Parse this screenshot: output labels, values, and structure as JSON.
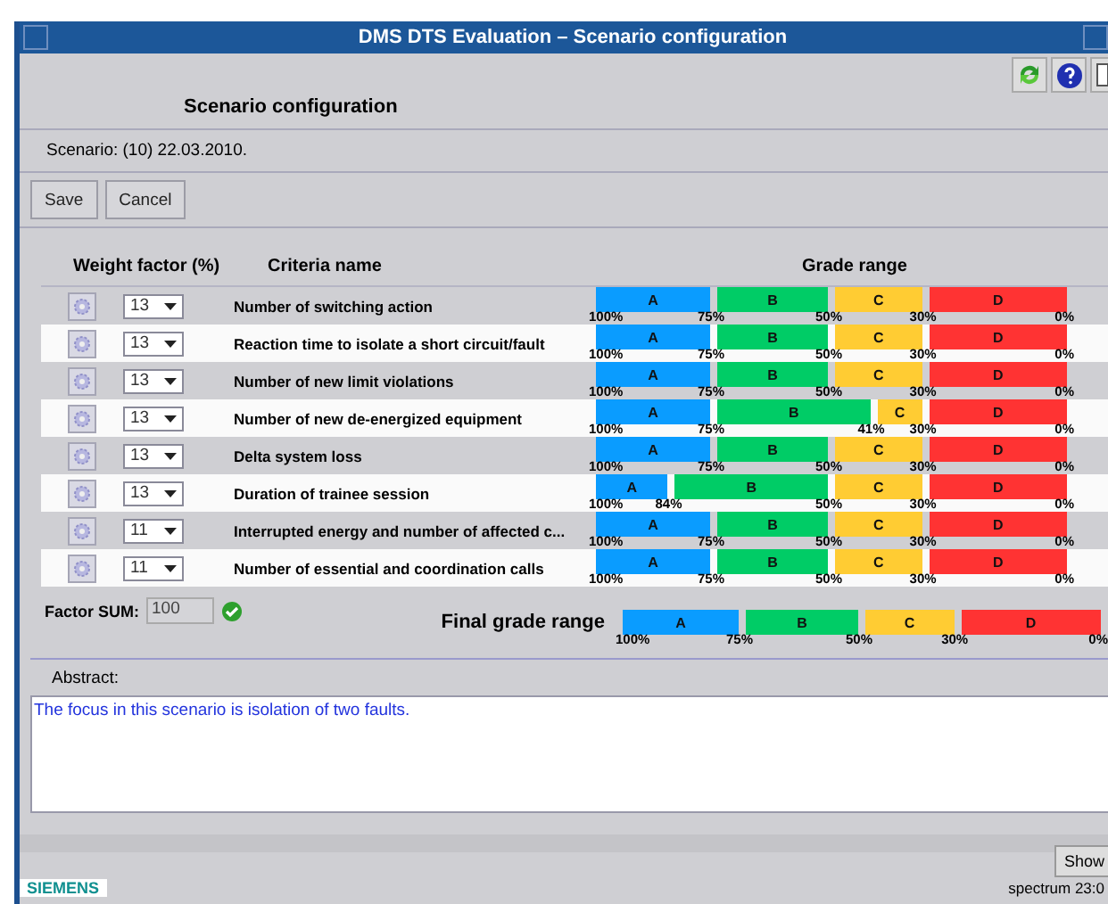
{
  "window": {
    "title": "DMS DTS Evaluation – Scenario configuration"
  },
  "heading": "Scenario configuration",
  "scenario": "Scenario: (10) 22.03.2010.",
  "buttons": [
    "Save",
    "Cancel"
  ],
  "columns": [
    "Weight factor (%)",
    "Criteria name",
    "Grade range"
  ],
  "criteria": [
    {
      "weight": "13",
      "name": "Number of switching action",
      "grades": [
        {
          "label": "A",
          "color": "#0a9cff"
        },
        {
          "label": "B",
          "color": "#00cc66"
        },
        {
          "label": "C",
          "color": "#ffcc33"
        },
        {
          "label": "D",
          "color": "#ff3333"
        }
      ],
      "ticks": [
        "100%",
        "75%",
        "50%",
        "30%",
        "0%"
      ]
    },
    {
      "weight": "13",
      "name": "Reaction time to isolate a short circuit/fault",
      "grades": [
        {
          "label": "A",
          "color": "#0a9cff"
        },
        {
          "label": "B",
          "color": "#00cc66"
        },
        {
          "label": "C",
          "color": "#ffcc33"
        },
        {
          "label": "D",
          "color": "#ff3333"
        }
      ],
      "ticks": [
        "100%",
        "75%",
        "50%",
        "30%",
        "0%"
      ]
    },
    {
      "weight": "13",
      "name": "Number of new limit violations",
      "grades": [
        {
          "label": "A",
          "color": "#0a9cff"
        },
        {
          "label": "B",
          "color": "#00cc66"
        },
        {
          "label": "C",
          "color": "#ffcc33"
        },
        {
          "label": "D",
          "color": "#ff3333"
        }
      ],
      "ticks": [
        "100%",
        "75%",
        "50%",
        "30%",
        "0%"
      ]
    },
    {
      "weight": "13",
      "name": "Number of new de-energized equipment",
      "grades": [
        {
          "label": "A",
          "color": "#0a9cff"
        },
        {
          "label": "B",
          "color": "#00cc66"
        },
        {
          "label": "C",
          "color": "#ffcc33"
        },
        {
          "label": "D",
          "color": "#ff3333"
        }
      ],
      "ticks": [
        "100%",
        "75%",
        "41%",
        "30%",
        "0%"
      ]
    },
    {
      "weight": "13",
      "name": "Delta system loss",
      "grades": [
        {
          "label": "A",
          "color": "#0a9cff"
        },
        {
          "label": "B",
          "color": "#00cc66"
        },
        {
          "label": "C",
          "color": "#ffcc33"
        },
        {
          "label": "D",
          "color": "#ff3333"
        }
      ],
      "ticks": [
        "100%",
        "75%",
        "50%",
        "30%",
        "0%"
      ]
    },
    {
      "weight": "13",
      "name": "Duration of trainee session",
      "grades": [
        {
          "label": "A",
          "color": "#0a9cff"
        },
        {
          "label": "B",
          "color": "#00cc66"
        },
        {
          "label": "C",
          "color": "#ffcc33"
        },
        {
          "label": "D",
          "color": "#ff3333"
        }
      ],
      "ticks": [
        "100%",
        "84%",
        "50%",
        "30%",
        "0%"
      ]
    },
    {
      "weight": "11",
      "name": "Interrupted energy and number of affected c...",
      "grades": [
        {
          "label": "A",
          "color": "#0a9cff"
        },
        {
          "label": "B",
          "color": "#00cc66"
        },
        {
          "label": "C",
          "color": "#ffcc33"
        },
        {
          "label": "D",
          "color": "#ff3333"
        }
      ],
      "ticks": [
        "100%",
        "75%",
        "50%",
        "30%",
        "0%"
      ]
    },
    {
      "weight": "11",
      "name": "Number of essential and coordination calls",
      "grades": [
        {
          "label": "A",
          "color": "#0a9cff"
        },
        {
          "label": "B",
          "color": "#00cc66"
        },
        {
          "label": "C",
          "color": "#ffcc33"
        },
        {
          "label": "D",
          "color": "#ff3333"
        }
      ],
      "ticks": [
        "100%",
        "75%",
        "50%",
        "30%",
        "0%"
      ]
    }
  ],
  "factor_sum": {
    "label": "Factor SUM:",
    "value": "100",
    "valid": true
  },
  "final_grade": {
    "label": "Final grade range",
    "grades": [
      {
        "label": "A",
        "color": "#0a9cff"
      },
      {
        "label": "B",
        "color": "#00cc66"
      },
      {
        "label": "C",
        "color": "#ffcc33"
      },
      {
        "label": "D",
        "color": "#ff3333"
      }
    ],
    "ticks": [
      "100%",
      "75%",
      "50%",
      "30%",
      "0%"
    ]
  },
  "abstract": {
    "label": "Abstract:",
    "value": "The focus in this scenario is isolation of two faults."
  },
  "show_button": "Show",
  "brand": "SIEMENS",
  "status": "spectrum 23:0"
}
